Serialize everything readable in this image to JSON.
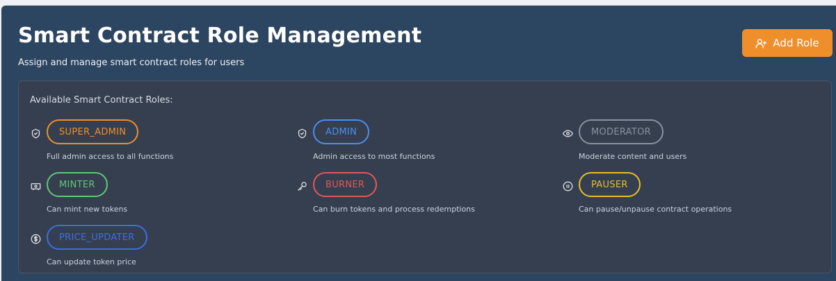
{
  "header": {
    "title": "Smart Contract Role Management",
    "subtitle": "Assign and manage smart contract roles for users",
    "add_role_label": "Add Role",
    "add_role_icon": "user-plus-icon"
  },
  "roles_section": {
    "heading": "Available Smart Contract Roles:",
    "roles": [
      {
        "name": "SUPER_ADMIN",
        "description": "Full admin access to all functions",
        "icon": "shield-check-icon",
        "color": "#ef8f2c"
      },
      {
        "name": "ADMIN",
        "description": "Admin access to most functions",
        "icon": "shield-check-icon",
        "color": "#4a8ff0"
      },
      {
        "name": "MODERATOR",
        "description": "Moderate content and users",
        "icon": "eye-icon",
        "color": "#8a929e"
      },
      {
        "name": "MINTER",
        "description": "Can mint new tokens",
        "icon": "banknote-icon",
        "color": "#5fc87a"
      },
      {
        "name": "BURNER",
        "description": "Can burn tokens and process redemptions",
        "icon": "key-icon",
        "color": "#e0585a"
      },
      {
        "name": "PAUSER",
        "description": "Can pause/unpause contract operations",
        "icon": "pause-circle-icon",
        "color": "#e7c02a"
      },
      {
        "name": "PRICE_UPDATER",
        "description": "Can update token price",
        "icon": "dollar-circle-icon",
        "color": "#3b6fe0"
      }
    ]
  }
}
